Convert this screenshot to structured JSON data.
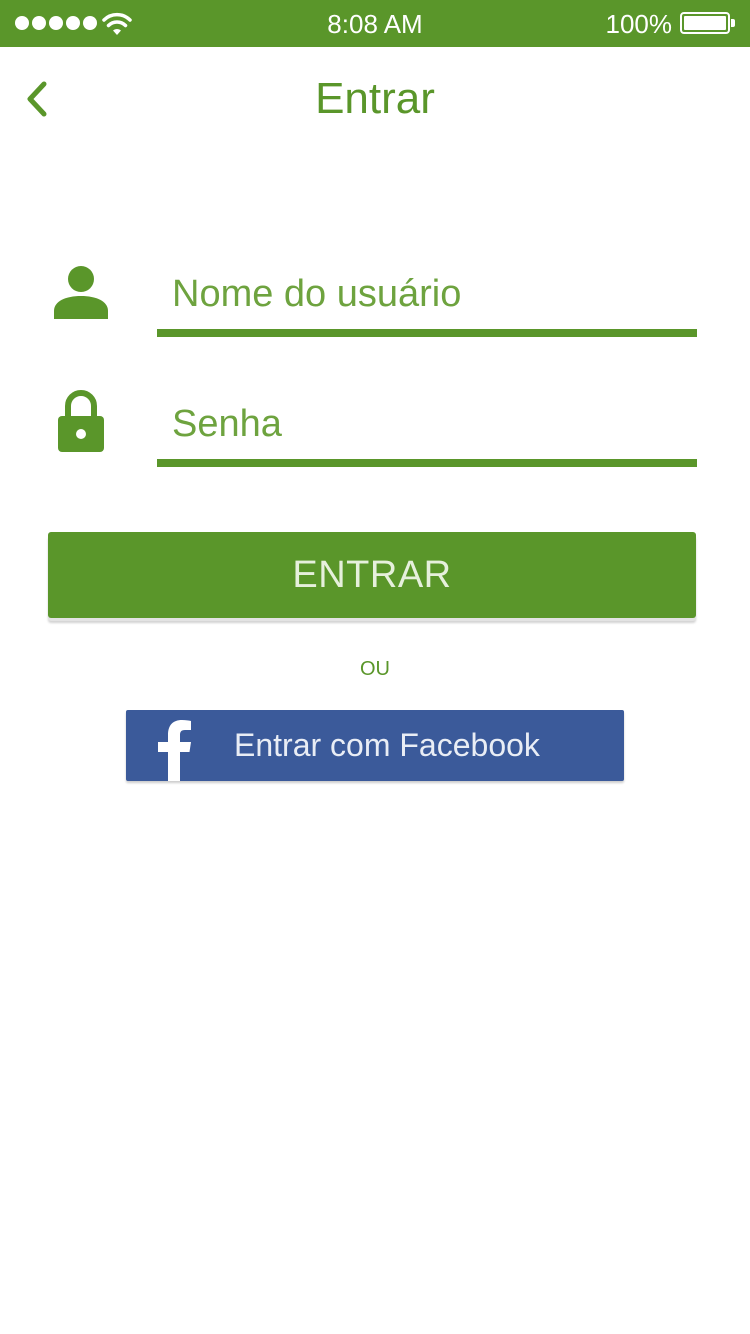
{
  "status_bar": {
    "time": "8:08 AM",
    "battery_percent": "100%",
    "signal_bars": 5,
    "icons": [
      "signal-dots-icon",
      "wifi-icon",
      "battery-icon"
    ]
  },
  "nav": {
    "title": "Entrar",
    "back_icon": "chevron-left-icon"
  },
  "form": {
    "username": {
      "placeholder": "Nome do usuário",
      "value": "",
      "icon": "user-icon"
    },
    "password": {
      "placeholder": "Senha",
      "value": "",
      "icon": "lock-icon"
    },
    "submit_label": "ENTRAR",
    "separator": "OU",
    "facebook_label": "Entrar com Facebook",
    "facebook_icon": "facebook-icon"
  },
  "colors": {
    "accent": "#5a962a",
    "facebook": "#3b5a9a",
    "background": "#ffffff"
  }
}
